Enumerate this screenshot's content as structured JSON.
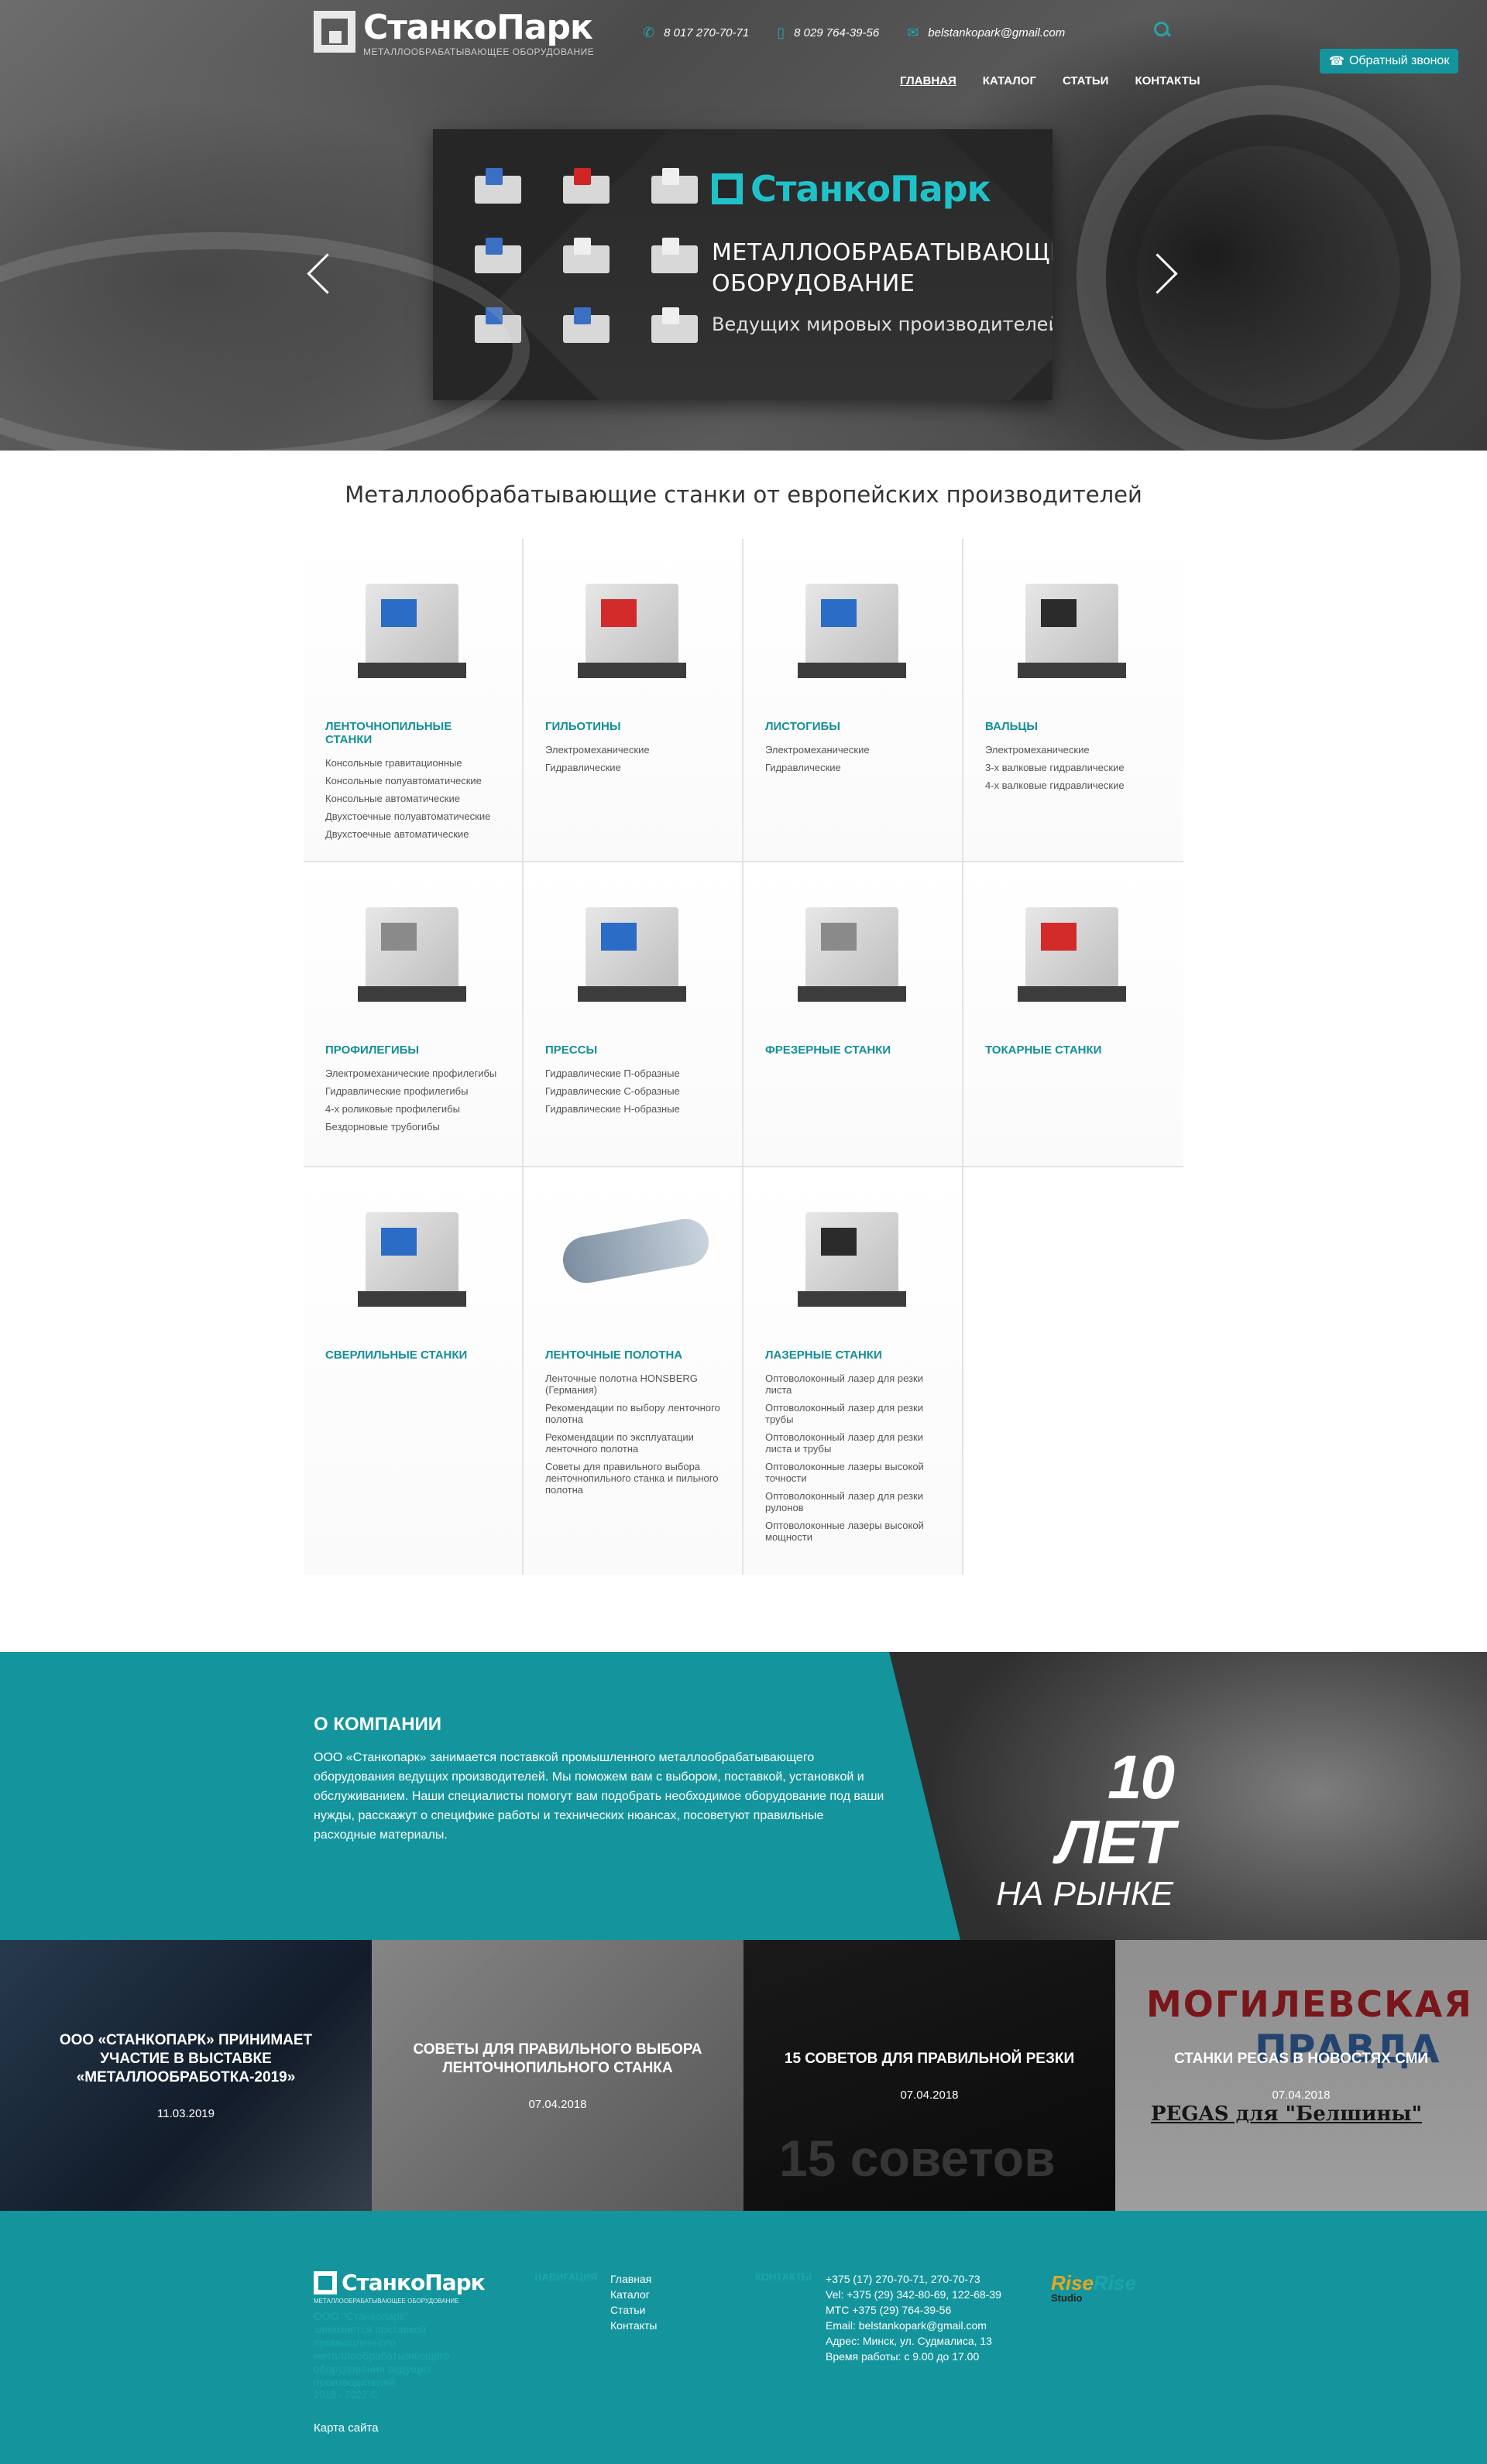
{
  "header": {
    "logo": {
      "name": "СтанкоПарк",
      "subtitle": "МЕТАЛЛООБРАБАТЫВАЮЩЕЕ ОБОРУДОВАНИЕ"
    },
    "phone1": "8 017 270-70-71",
    "phone2": "8 029 764-39-56",
    "email": "belstankopark@gmail.com",
    "callback_label": "Обратный звонок",
    "nav": [
      "ГЛАВНАЯ",
      "КАТАЛОГ",
      "СТАТЬИ",
      "КОНТАКТЫ"
    ]
  },
  "slider": {
    "logo": "СтанкоПарк",
    "title_line1": "МЕТАЛЛООБРАБАТЫВАЮЩЕЕ",
    "title_line2": "ОБОРУДОВАНИЕ",
    "subtitle": "Ведущих мировых производителей"
  },
  "catalog": {
    "title": "Металлообрабатывающие станки от европейских производителей",
    "categories": [
      {
        "name": "ЛЕНТОЧНОПИЛЬНЫЕ СТАНКИ",
        "items": [
          "Консольные гравитационные",
          "Консольные полуавтоматические",
          "Консольные автоматические",
          "Двухстоечные полуавтоматические",
          "Двухстоечные автоматические"
        ]
      },
      {
        "name": "ГИЛЬОТИНЫ",
        "items": [
          "Электромеханические",
          "Гидравлические"
        ]
      },
      {
        "name": "ЛИСТОГИБЫ",
        "items": [
          "Электромеханические",
          "Гидравлические"
        ]
      },
      {
        "name": "ВАЛЬЦЫ",
        "items": [
          "Электромеханические",
          "3-х валковые гидравлические",
          "4-х валковые гидравлические"
        ]
      },
      {
        "name": "ПРОФИЛЕГИБЫ",
        "items": [
          "Электромеханические профилегибы",
          "Гидравлические профилегибы",
          "4-х роликовые профилегибы",
          "Бездорновые трубогибы"
        ]
      },
      {
        "name": "ПРЕССЫ",
        "items": [
          "Гидравлические П-образные",
          "Гидравлические С-образные",
          "Гидравлические Н-образные"
        ]
      },
      {
        "name": "ФРЕЗЕРНЫЕ СТАНКИ",
        "items": []
      },
      {
        "name": "ТОКАРНЫЕ СТАНКИ",
        "items": []
      },
      {
        "name": "СВЕРЛИЛЬНЫЕ СТАНКИ",
        "items": []
      },
      {
        "name": "ЛЕНТОЧНЫЕ ПОЛОТНА",
        "items": [
          "Ленточные полотна HONSBERG (Германия)",
          "Рекомендации по выбору ленточного полотна",
          "Рекомендации по эксплуатации ленточного полотна",
          "Советы для правильного выбора ленточнопильного станка и пильного полотна"
        ]
      },
      {
        "name": "ЛАЗЕРНЫЕ СТАНКИ",
        "items": [
          "Оптоволоконный лазер для резки листа",
          "Оптоволоконный лазер для резки трубы",
          "Оптоволоконный лазер для резки листа и трубы",
          "Оптоволоконные лазеры высокой точности",
          "Оптоволоконный лазер для резки рулонов",
          "Оптоволоконные лазеры высокой мощности"
        ]
      }
    ]
  },
  "about": {
    "title": "О КОМПАНИИ",
    "text": "ООО «Станкопарк» занимается поставкой промышленного металлообрабатывающего оборудования ведущих производителей. Мы поможем вам с выбором, поставкой, установкой и обслуживанием. Наши специалисты помогут вам подобрать необходимое оборудование под ваши нужды, расскажут о специфике работы и технических нюансах, посоветуют правильные расходные материалы.",
    "years_big": "10 ЛЕТ",
    "years_small": "НА РЫНКЕ"
  },
  "news": [
    {
      "title": "ООО «СТАНКОПАРК» ПРИНИМАЕТ УЧАСТИЕ В ВЫСТАВКЕ «МЕТАЛЛООБРАБОТКА-2019»",
      "date": "11.03.2019"
    },
    {
      "title": "СОВЕТЫ ДЛЯ ПРАВИЛЬНОГО ВЫБОРА ЛЕНТОЧНОПИЛЬНОГО СТАНКА",
      "date": "07.04.2018"
    },
    {
      "title": "15 СОВЕТОВ ДЛЯ ПРАВИЛЬНОЙ РЕЗКИ",
      "date": "07.04.2018",
      "image_text": "15 советов"
    },
    {
      "title": "СТАНКИ PEGAS В НОВОСТЯХ СМИ",
      "date": "07.04.2018",
      "image_text1": "МОГИЛЕВСКАЯ",
      "image_text2": "ПРАВДА",
      "image_text3": "PEGAS для \"Белшины\""
    }
  ],
  "footer": {
    "logo_name": "СтанкоПарк",
    "logo_sub": "МЕТАЛЛООБРАБАТЫВАЮЩЕЕ ОБОРУДОВАНИЕ",
    "description": "ООО \"Станкопарк\" занимается поставкой промышленного металлообрабатывающего оборудования ведущих производителей",
    "copyright": "2018 - 2022 ©",
    "sitemap": "Карта сайта",
    "nav_label": "НАВИГАЦИЯ",
    "nav": [
      "Главная",
      "Каталог",
      "Статьи",
      "Контакты"
    ],
    "contacts_label": "КОНТАКТЫ",
    "contacts": [
      "+375 (17) 270-70-71, 270-70-73",
      "Vel: +375 (29) 342-80-69, 122-68-39",
      "МТС +375 (29) 764-39-56",
      "Email: belstankopark@gmail.com",
      "Адрес: Минск, ул. Судмалиса, 13",
      "Время работы: с 9.00 до 17.00"
    ],
    "studio_part1": "Rise",
    "studio_part2": "Rise",
    "studio_bottom": "Studio"
  },
  "colors": {
    "accent": "#14959d",
    "accent_light": "#1fc2c8",
    "studio_orange": "#e4a821"
  }
}
